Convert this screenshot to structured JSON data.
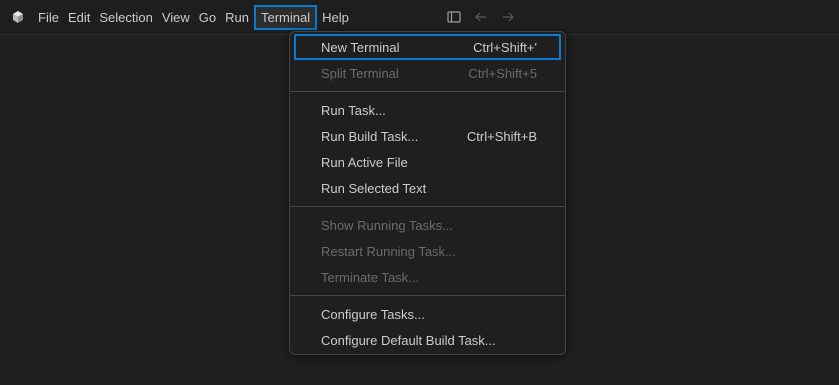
{
  "menubar": {
    "items": [
      "File",
      "Edit",
      "Selection",
      "View",
      "Go",
      "Run",
      "Terminal",
      "Help"
    ],
    "active_index": 6
  },
  "icons": {
    "app": "vscode-insiders-logo-icon",
    "layout": "toggle-primary-sidebar-icon",
    "back": "arrow-left-icon",
    "forward": "arrow-right-icon"
  },
  "terminal_menu": {
    "groups": [
      [
        {
          "label": "New Terminal",
          "shortcut": "Ctrl+Shift+'",
          "enabled": true,
          "focused": true
        },
        {
          "label": "Split Terminal",
          "shortcut": "Ctrl+Shift+5",
          "enabled": false
        }
      ],
      [
        {
          "label": "Run Task...",
          "shortcut": "",
          "enabled": true
        },
        {
          "label": "Run Build Task...",
          "shortcut": "Ctrl+Shift+B",
          "enabled": true
        },
        {
          "label": "Run Active File",
          "shortcut": "",
          "enabled": true
        },
        {
          "label": "Run Selected Text",
          "shortcut": "",
          "enabled": true
        }
      ],
      [
        {
          "label": "Show Running Tasks...",
          "shortcut": "",
          "enabled": false
        },
        {
          "label": "Restart Running Task...",
          "shortcut": "",
          "enabled": false
        },
        {
          "label": "Terminate Task...",
          "shortcut": "",
          "enabled": false
        }
      ],
      [
        {
          "label": "Configure Tasks...",
          "shortcut": "",
          "enabled": true
        },
        {
          "label": "Configure Default Build Task...",
          "shortcut": "",
          "enabled": true
        }
      ]
    ]
  },
  "colors": {
    "background": "#1e1e1e",
    "focus_border": "#0b7ad1",
    "text": "#cccccc",
    "disabled_text": "#6b6b6b"
  }
}
